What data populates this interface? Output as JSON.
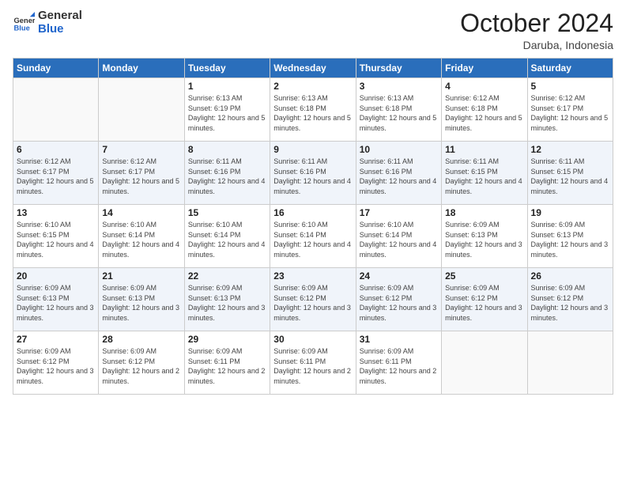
{
  "logo": {
    "general": "General",
    "blue": "Blue"
  },
  "title": "October 2024",
  "subtitle": "Daruba, Indonesia",
  "weekdays": [
    "Sunday",
    "Monday",
    "Tuesday",
    "Wednesday",
    "Thursday",
    "Friday",
    "Saturday"
  ],
  "weeks": [
    [
      {
        "day": "",
        "info": ""
      },
      {
        "day": "",
        "info": ""
      },
      {
        "day": "1",
        "info": "Sunrise: 6:13 AM\nSunset: 6:19 PM\nDaylight: 12 hours and 5 minutes."
      },
      {
        "day": "2",
        "info": "Sunrise: 6:13 AM\nSunset: 6:18 PM\nDaylight: 12 hours and 5 minutes."
      },
      {
        "day": "3",
        "info": "Sunrise: 6:13 AM\nSunset: 6:18 PM\nDaylight: 12 hours and 5 minutes."
      },
      {
        "day": "4",
        "info": "Sunrise: 6:12 AM\nSunset: 6:18 PM\nDaylight: 12 hours and 5 minutes."
      },
      {
        "day": "5",
        "info": "Sunrise: 6:12 AM\nSunset: 6:17 PM\nDaylight: 12 hours and 5 minutes."
      }
    ],
    [
      {
        "day": "6",
        "info": "Sunrise: 6:12 AM\nSunset: 6:17 PM\nDaylight: 12 hours and 5 minutes."
      },
      {
        "day": "7",
        "info": "Sunrise: 6:12 AM\nSunset: 6:17 PM\nDaylight: 12 hours and 5 minutes."
      },
      {
        "day": "8",
        "info": "Sunrise: 6:11 AM\nSunset: 6:16 PM\nDaylight: 12 hours and 4 minutes."
      },
      {
        "day": "9",
        "info": "Sunrise: 6:11 AM\nSunset: 6:16 PM\nDaylight: 12 hours and 4 minutes."
      },
      {
        "day": "10",
        "info": "Sunrise: 6:11 AM\nSunset: 6:16 PM\nDaylight: 12 hours and 4 minutes."
      },
      {
        "day": "11",
        "info": "Sunrise: 6:11 AM\nSunset: 6:15 PM\nDaylight: 12 hours and 4 minutes."
      },
      {
        "day": "12",
        "info": "Sunrise: 6:11 AM\nSunset: 6:15 PM\nDaylight: 12 hours and 4 minutes."
      }
    ],
    [
      {
        "day": "13",
        "info": "Sunrise: 6:10 AM\nSunset: 6:15 PM\nDaylight: 12 hours and 4 minutes."
      },
      {
        "day": "14",
        "info": "Sunrise: 6:10 AM\nSunset: 6:14 PM\nDaylight: 12 hours and 4 minutes."
      },
      {
        "day": "15",
        "info": "Sunrise: 6:10 AM\nSunset: 6:14 PM\nDaylight: 12 hours and 4 minutes."
      },
      {
        "day": "16",
        "info": "Sunrise: 6:10 AM\nSunset: 6:14 PM\nDaylight: 12 hours and 4 minutes."
      },
      {
        "day": "17",
        "info": "Sunrise: 6:10 AM\nSunset: 6:14 PM\nDaylight: 12 hours and 4 minutes."
      },
      {
        "day": "18",
        "info": "Sunrise: 6:09 AM\nSunset: 6:13 PM\nDaylight: 12 hours and 3 minutes."
      },
      {
        "day": "19",
        "info": "Sunrise: 6:09 AM\nSunset: 6:13 PM\nDaylight: 12 hours and 3 minutes."
      }
    ],
    [
      {
        "day": "20",
        "info": "Sunrise: 6:09 AM\nSunset: 6:13 PM\nDaylight: 12 hours and 3 minutes."
      },
      {
        "day": "21",
        "info": "Sunrise: 6:09 AM\nSunset: 6:13 PM\nDaylight: 12 hours and 3 minutes."
      },
      {
        "day": "22",
        "info": "Sunrise: 6:09 AM\nSunset: 6:13 PM\nDaylight: 12 hours and 3 minutes."
      },
      {
        "day": "23",
        "info": "Sunrise: 6:09 AM\nSunset: 6:12 PM\nDaylight: 12 hours and 3 minutes."
      },
      {
        "day": "24",
        "info": "Sunrise: 6:09 AM\nSunset: 6:12 PM\nDaylight: 12 hours and 3 minutes."
      },
      {
        "day": "25",
        "info": "Sunrise: 6:09 AM\nSunset: 6:12 PM\nDaylight: 12 hours and 3 minutes."
      },
      {
        "day": "26",
        "info": "Sunrise: 6:09 AM\nSunset: 6:12 PM\nDaylight: 12 hours and 3 minutes."
      }
    ],
    [
      {
        "day": "27",
        "info": "Sunrise: 6:09 AM\nSunset: 6:12 PM\nDaylight: 12 hours and 3 minutes."
      },
      {
        "day": "28",
        "info": "Sunrise: 6:09 AM\nSunset: 6:12 PM\nDaylight: 12 hours and 2 minutes."
      },
      {
        "day": "29",
        "info": "Sunrise: 6:09 AM\nSunset: 6:11 PM\nDaylight: 12 hours and 2 minutes."
      },
      {
        "day": "30",
        "info": "Sunrise: 6:09 AM\nSunset: 6:11 PM\nDaylight: 12 hours and 2 minutes."
      },
      {
        "day": "31",
        "info": "Sunrise: 6:09 AM\nSunset: 6:11 PM\nDaylight: 12 hours and 2 minutes."
      },
      {
        "day": "",
        "info": ""
      },
      {
        "day": "",
        "info": ""
      }
    ]
  ]
}
